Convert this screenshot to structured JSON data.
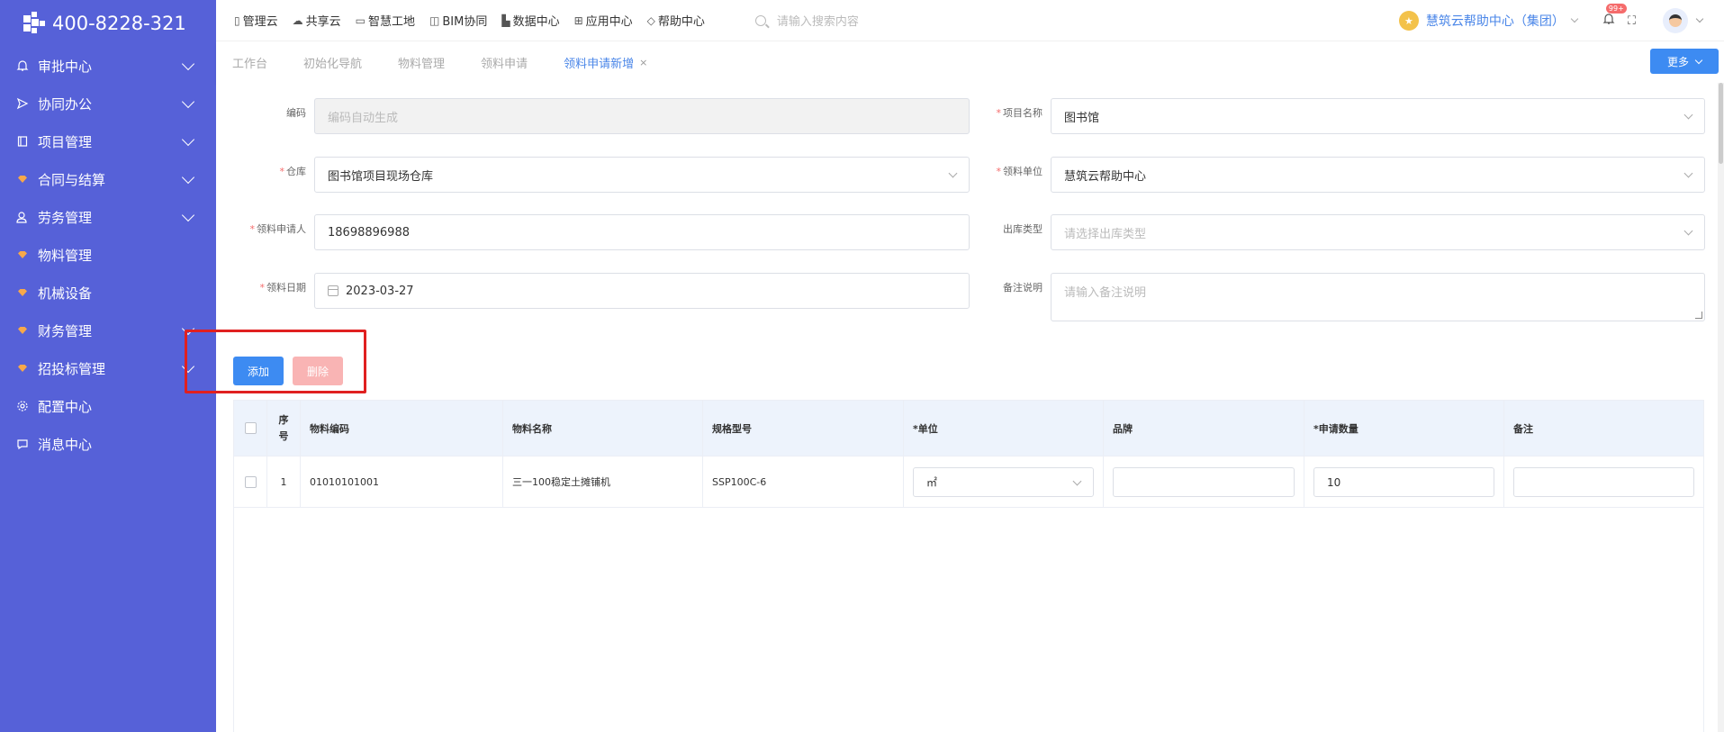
{
  "sidebar": {
    "phone": "400-8228-321",
    "items": [
      {
        "label": "审批中心",
        "icon": "bell-icon",
        "has_children": true
      },
      {
        "label": "协同办公",
        "icon": "send-icon",
        "has_children": true
      },
      {
        "label": "项目管理",
        "icon": "book-icon",
        "has_children": true
      },
      {
        "label": "合同与结算",
        "icon": "gem-icon",
        "has_children": true
      },
      {
        "label": "劳务管理",
        "icon": "worker-icon",
        "has_children": true
      },
      {
        "label": "物料管理",
        "icon": "gem-icon",
        "has_children": false
      },
      {
        "label": "机械设备",
        "icon": "gem-icon",
        "has_children": false
      },
      {
        "label": "财务管理",
        "icon": "gem-icon",
        "has_children": true
      },
      {
        "label": "招投标管理",
        "icon": "gem-icon",
        "has_children": true
      },
      {
        "label": "配置中心",
        "icon": "gear-icon",
        "has_children": false
      },
      {
        "label": "消息中心",
        "icon": "chat-icon",
        "has_children": false
      }
    ]
  },
  "topnav": {
    "items": [
      {
        "label": "管理云",
        "icon": "doc-icon"
      },
      {
        "label": "共享云",
        "icon": "cloud-icon"
      },
      {
        "label": "智慧工地",
        "icon": "book-icon"
      },
      {
        "label": "BIM协同",
        "icon": "box-icon"
      },
      {
        "label": "数据中心",
        "icon": "bar-chart-icon"
      },
      {
        "label": "应用中心",
        "icon": "grid-icon"
      },
      {
        "label": "帮助中心",
        "icon": "diamond-icon"
      }
    ],
    "search_placeholder": "请输入搜索内容",
    "org_name": "慧筑云帮助中心（集团）",
    "notification_badge": "99+"
  },
  "tabs": {
    "items": [
      "工作台",
      "初始化导航",
      "物料管理",
      "领料申请"
    ],
    "active": "领料申请新增",
    "close": "×",
    "more_label": "更多"
  },
  "form": {
    "code_label": "编码",
    "code_placeholder": "编码自动生成",
    "project_label": "项目名称",
    "project_value": "图书馆",
    "warehouse_label": "仓库",
    "warehouse_value": "图书馆项目现场仓库",
    "unit_label": "领料单位",
    "unit_value": "慧筑云帮助中心",
    "applicant_label": "领料申请人",
    "applicant_value": "18698896988",
    "outtype_label": "出库类型",
    "outtype_placeholder": "请选择出库类型",
    "date_label": "领料日期",
    "date_value": "2023-03-27",
    "remark_label": "备注说明",
    "remark_placeholder": "请输入备注说明",
    "required_mark": "*"
  },
  "actions": {
    "add_label": "添加",
    "delete_label": "删除"
  },
  "table": {
    "headers": {
      "seq": "序号",
      "code": "物料编码",
      "name": "物料名称",
      "spec": "规格型号",
      "unit": "*单位",
      "brand": "品牌",
      "qty": "*申请数量",
      "remark": "备注"
    },
    "rows": [
      {
        "seq": "1",
        "code": "01010101001",
        "name": "三一100稳定土摊铺机",
        "spec": "SSP100C-6",
        "unit": "㎡",
        "brand": "",
        "qty": "10",
        "remark": ""
      }
    ]
  }
}
